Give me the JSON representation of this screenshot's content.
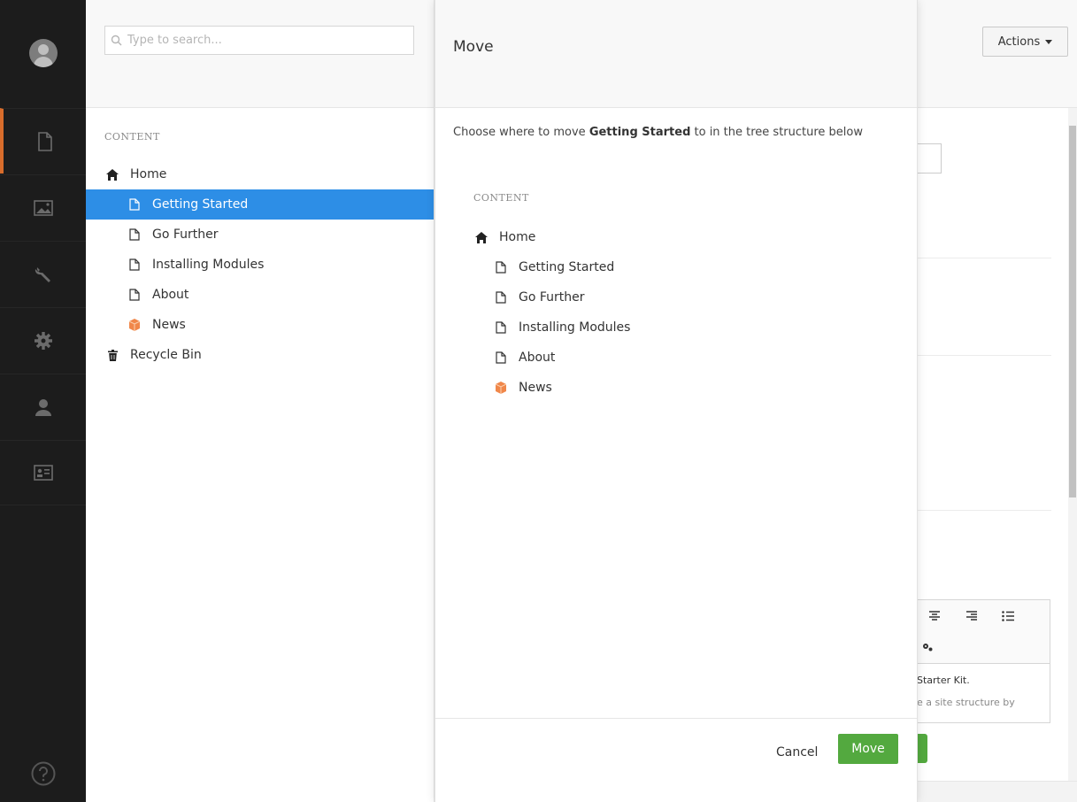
{
  "rail": {
    "items": [
      {
        "icon": "document-icon"
      },
      {
        "icon": "media-icon"
      },
      {
        "icon": "wrench-icon"
      },
      {
        "icon": "gear-icon"
      },
      {
        "icon": "user-icon"
      },
      {
        "icon": "contact-card-icon"
      }
    ],
    "help_icon": "help-icon",
    "active_color": "#d86c2b"
  },
  "tree": {
    "search_placeholder": "Type to search...",
    "section_title": "CONTENT",
    "home": "Home",
    "children": [
      "Getting Started",
      "Go Further",
      "Installing Modules",
      "About",
      "News"
    ],
    "recycle_bin": "Recycle Bin",
    "selected": "Getting Started",
    "selected_color": "#2d8ee6"
  },
  "dialog": {
    "title": "Move",
    "desc_before": "Choose where to move ",
    "desc_item": "Getting Started",
    "desc_after": " to in the tree structure below",
    "section_title": "CONTENT",
    "home": "Home",
    "children": [
      "Getting Started",
      "Go Further",
      "Installing Modules",
      "About",
      "News"
    ],
    "cancel_label": "Cancel",
    "move_label": "Move",
    "move_color": "#53a93f"
  },
  "background": {
    "actions_label": "Actions",
    "editor_text_1": "Starter Kit.",
    "editor_text_2": "e a site structure by"
  }
}
